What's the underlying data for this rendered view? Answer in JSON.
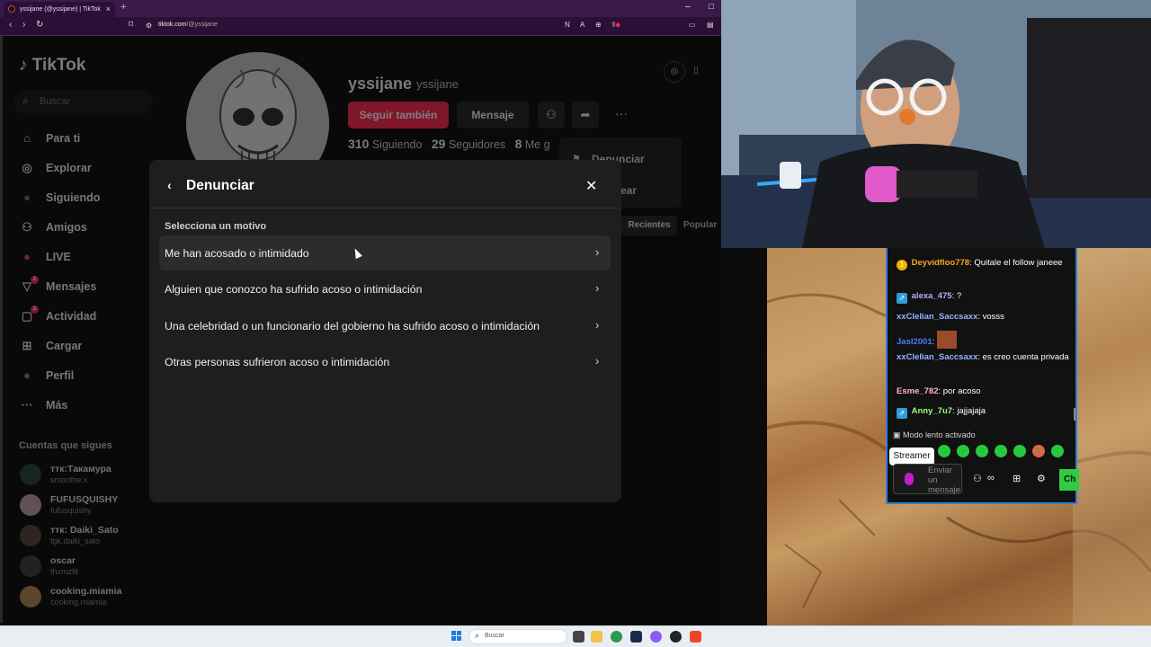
{
  "browser": {
    "tab_title": "yssijane (@yssijane) | TikTok",
    "url_host": "tiktok.com",
    "url_path": "/@yssijane",
    "new_tab": "+"
  },
  "sidebar": {
    "logo": "TikTok",
    "search_placeholder": "Buscar",
    "items": [
      {
        "label": "Para ti",
        "icon": "home-icon"
      },
      {
        "label": "Explorar",
        "icon": "compass-icon"
      },
      {
        "label": "Siguiendo",
        "icon": "following-icon"
      },
      {
        "label": "Amigos",
        "icon": "friends-icon"
      },
      {
        "label": "LIVE",
        "icon": "live-icon"
      },
      {
        "label": "Mensajes",
        "icon": "messages-icon",
        "badge": "2"
      },
      {
        "label": "Actividad",
        "icon": "activity-icon",
        "badge": "2"
      },
      {
        "label": "Cargar",
        "icon": "upload-icon"
      },
      {
        "label": "Perfil",
        "icon": "profile-icon"
      },
      {
        "label": "Más",
        "icon": "more-icon"
      }
    ],
    "following_header": "Cuentas que sigues",
    "following": [
      {
        "name": "ттк:Такамура",
        "user": "smoothe.x"
      },
      {
        "name": "FUFUSQUISHY",
        "user": "fufusquishy"
      },
      {
        "name": "ттк: Daiki_Sato",
        "user": "tgk.daiki_sato"
      },
      {
        "name": "oscar",
        "user": "thxmzfit"
      },
      {
        "name": "cooking.miamia",
        "user": "cooking.miamia"
      }
    ]
  },
  "profile": {
    "display_name": "yssijane",
    "username": "yssijane",
    "follow_button": "Seguir también",
    "message_button": "Mensaje",
    "following_count": "310",
    "following_label": "Siguiendo",
    "followers_count": "29",
    "followers_label": "Seguidores",
    "likes_count": "8",
    "likes_label": "Me g",
    "dropdown": {
      "report": "Denunciar",
      "block": "ear"
    },
    "tabs": {
      "recent": "Recientes",
      "popular": "Popular"
    }
  },
  "modal": {
    "title": "Denunciar",
    "subtitle": "Selecciona un motivo",
    "reasons": [
      "Me han acosado o intimidado",
      "Alguien que conozco ha sufrido acoso o intimidación",
      "Una celebridad o un funcionario del gobierno ha sufrido acoso o intimidación",
      "Otras personas sufrieron acoso o intimidación"
    ]
  },
  "chat": {
    "messages": [
      {
        "user": "Deyvidfloo778",
        "text": ": Quitale el follow janeee",
        "color": "#f5a623",
        "badge": "1"
      },
      {
        "user": "alexa_475",
        "text": ": ?",
        "color": "#bfa9ff",
        "badge": "channel"
      },
      {
        "user": "xxClelian_Saccsaxx",
        "text": ": vosss",
        "color": "#8fb6ff"
      },
      {
        "user": "Jasl2001",
        "text": ":",
        "color": "#4b7bff",
        "emote": true
      },
      {
        "user": "xxClelian_Saccsaxx",
        "text": ": es creo cuenta privada",
        "color": "#8fb6ff"
      },
      {
        "user": "Esme_782",
        "text": ": por acoso",
        "color": "#ffb3c8"
      },
      {
        "user": "Anny_7u7",
        "text": ": jajjajaja",
        "color": "#9cff7a",
        "badge": "channel"
      }
    ],
    "slow_mode": "Modo lento activado",
    "streamer_tooltip": "Streamer",
    "input_placeholder": "Enviar un mensaje",
    "send_label": "Ch"
  },
  "taskbar": {
    "search_placeholder": "Buscar"
  }
}
